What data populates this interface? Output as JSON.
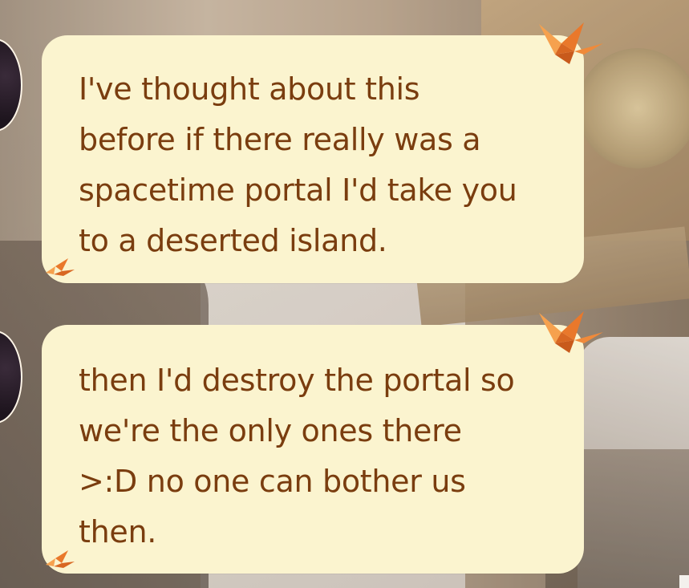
{
  "messages": [
    {
      "text": "I've thought about this\nbefore if there really was a\nspacetime portal I'd take you\nto a deserted island."
    },
    {
      "text": "then I'd destroy the portal so\nwe're the only ones there\n>:D no one can bother us\nthen."
    }
  ],
  "icons": {
    "decoration": "paper-crane-icon",
    "avatar": "avatar"
  },
  "colors": {
    "bubble_bg": "#fbf4cf",
    "text": "#7a3d0f",
    "crane": "#f08a3a"
  }
}
